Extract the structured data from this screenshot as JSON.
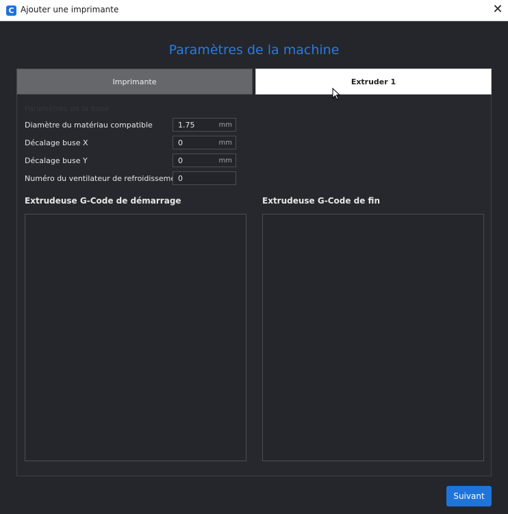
{
  "window": {
    "title": "Ajouter une imprimante",
    "icon": "cura-logo-icon",
    "close_glyph": "✕",
    "icon_letter": "C"
  },
  "page": {
    "title": "Paramètres de la machine"
  },
  "tabs": [
    {
      "label": "Imprimante",
      "selected": false
    },
    {
      "label": "Extruder 1",
      "selected": true
    }
  ],
  "extruder": {
    "section_label": "Paramètres de la buse",
    "fields": [
      {
        "label": "Diamètre du matériau compatible",
        "value": "1.75",
        "unit": "mm"
      },
      {
        "label": "Décalage buse X",
        "value": "0",
        "unit": "mm"
      },
      {
        "label": "Décalage buse Y",
        "value": "0",
        "unit": "mm"
      },
      {
        "label": "Numéro du ventilateur de refroidissement",
        "value": "0",
        "unit": ""
      }
    ],
    "start_gcode": {
      "label": "Extrudeuse G-Code de démarrage",
      "value": ""
    },
    "end_gcode": {
      "label": "Extrudeuse G-Code de fin",
      "value": ""
    }
  },
  "footer": {
    "next_label": "Suivant"
  },
  "colors": {
    "accent": "#1f74d9",
    "background": "#24262b",
    "title": "#2a7be0"
  }
}
